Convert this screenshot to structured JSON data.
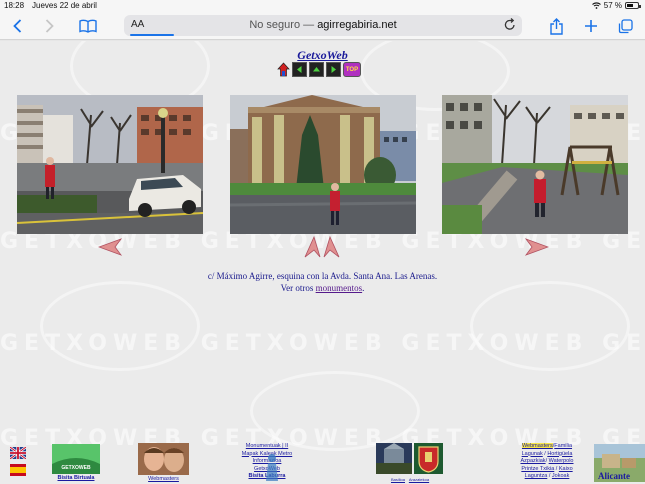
{
  "status_bar": {
    "time": "18:28",
    "date": "Jueves 22 de abril",
    "battery": "57 %",
    "battery_level": 0.57
  },
  "browser": {
    "text_size_label": "AA",
    "url_prefix": "No seguro —",
    "url_domain": "agirregabiria.net",
    "accent_color": "#1a73e8"
  },
  "page": {
    "site_title": "GetxoWeb",
    "nav_buttons": [
      "home",
      "previous",
      "up",
      "next",
      "top"
    ],
    "top_label": "TOP",
    "watermark_text": "GETXOWEB GETXOWEB GETXOWEB GETXOWEB",
    "caption_line1": "c/ Máximo Agirre, esquina con la Avda. Santa Ana. Las Arenas.",
    "caption_line2_prefix": "Ver otros",
    "caption_link": "monumentos",
    "caption_line2_suffix": "."
  },
  "footer": {
    "bisita_birtuala": "Bisita Birtuala",
    "getxoweb_logo_text": "GETXOWEB",
    "webmasters_link": "Webmasters",
    "center_links": [
      "Monumentuak | II",
      "Mapak Kaleak Metro",
      "Informazioa",
      "GetxoWeb",
      "Bisita Laburra"
    ],
    "small_labels": [
      "Basilioa",
      "Arazatekoa"
    ],
    "right_links": [
      [
        "Webmasters",
        "/",
        "Familia"
      ],
      [
        "Lagunak",
        " / ",
        "Hortigüela"
      ],
      [
        "Azpazkiak",
        "/ ",
        "Waterpolo"
      ],
      [
        "Printze Txikia",
        " / ",
        "Kaixo"
      ],
      [
        "Laguntza",
        " / ",
        "Jokoak"
      ]
    ],
    "alicante_label": "Alicante"
  }
}
